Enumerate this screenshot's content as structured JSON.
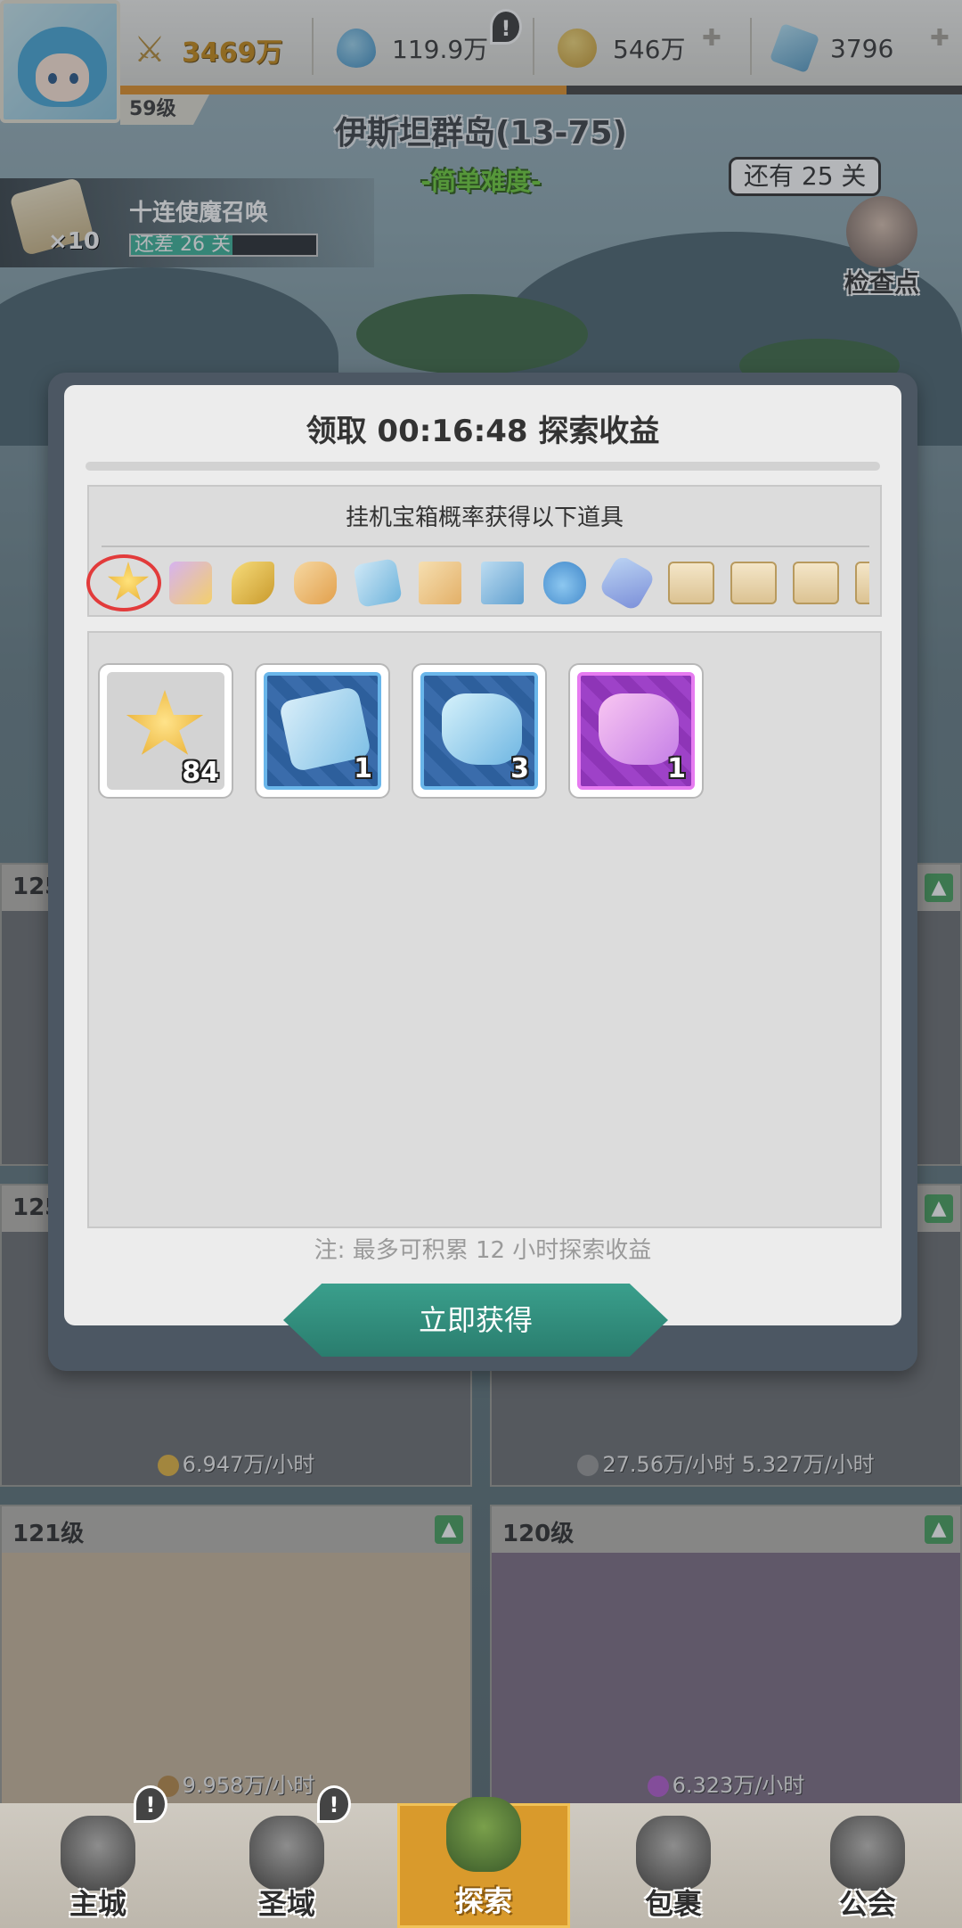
{
  "header": {
    "power": "3469万",
    "resources": [
      {
        "icon": "water-drop-icon",
        "value": "119.9万"
      },
      {
        "icon": "gold-coin-icon",
        "value": "546万"
      },
      {
        "icon": "blue-crystal-icon",
        "value": "3796"
      }
    ],
    "level": "59级",
    "alert_mark": "!"
  },
  "stage": {
    "title": "伊斯坦群岛(13-75)",
    "difficulty": "-简单难度-"
  },
  "summon": {
    "multiplier": "×10",
    "name": "十连使魔召唤",
    "progress_text": "还差 26 关",
    "progress_fraction": 0.55
  },
  "checkpoint": {
    "bubble": "还有 25 关",
    "label": "检查点"
  },
  "bg_cards": [
    {
      "level": "125",
      "rate": ""
    },
    {
      "level": "125",
      "rate": "6.947万/小时"
    },
    {
      "level": "",
      "rate": "27.56万/小时  5.327万/小时"
    },
    {
      "level": "121级",
      "rate": "9.958万/小时"
    },
    {
      "level": "120级",
      "rate": "6.323万/小时"
    }
  ],
  "modal": {
    "title": "领取 00:16:48 探索收益",
    "possible_label": "挂机宝箱概率获得以下道具",
    "possible_items": [
      "star-icon",
      "chest-icon",
      "key-icon",
      "ore-icon",
      "blueprint-icon",
      "map-icon",
      "blue-map-icon",
      "potion-icon",
      "gem-icon",
      "ticket-icon",
      "ticket-icon",
      "ticket-icon",
      "ticket-icon"
    ],
    "rewards": [
      {
        "icon": "gold-star-icon",
        "count": "84",
        "rarity": "grey"
      },
      {
        "icon": "blue-scroll-icon",
        "count": "1",
        "rarity": "blue"
      },
      {
        "icon": "blue-ore-icon",
        "count": "3",
        "rarity": "blue"
      },
      {
        "icon": "purple-ore-icon",
        "count": "1",
        "rarity": "purple"
      }
    ],
    "note": "注: 最多可积累 12 小时探索收益",
    "claim_label": "立即获得"
  },
  "nav": [
    {
      "label": "主城",
      "badge": "!"
    },
    {
      "label": "圣域",
      "badge": "!"
    },
    {
      "label": "探索",
      "badge": ""
    },
    {
      "label": "包裹",
      "badge": ""
    },
    {
      "label": "公会",
      "badge": ""
    }
  ],
  "colors": {
    "accent_teal": "#2a7d6e",
    "active_tab": "#d99a2c",
    "circle_mark": "#e23b3b"
  }
}
